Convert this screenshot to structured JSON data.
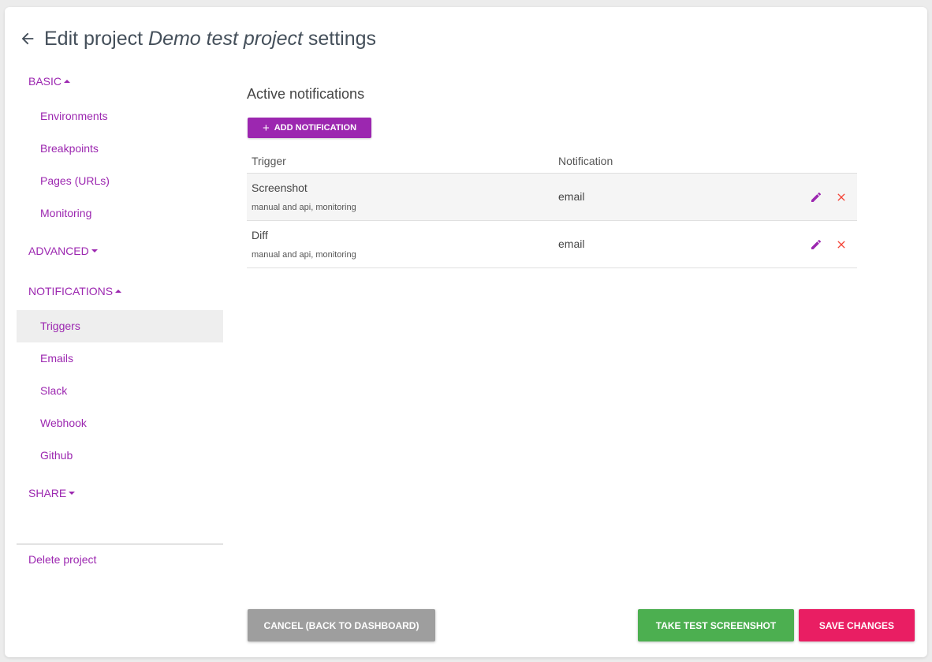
{
  "header": {
    "title_prefix": "Edit project",
    "project_name": "Demo test project",
    "title_suffix": "settings"
  },
  "sidebar": {
    "basic": {
      "label": "BASIC",
      "expanded": true,
      "items": [
        "Environments",
        "Breakpoints",
        "Pages (URLs)",
        "Monitoring"
      ]
    },
    "advanced": {
      "label": "ADVANCED",
      "expanded": false
    },
    "notifications": {
      "label": "NOTIFICATIONS",
      "expanded": true,
      "items": [
        "Triggers",
        "Emails",
        "Slack",
        "Webhook",
        "Github"
      ],
      "active": "Triggers"
    },
    "share": {
      "label": "SHARE",
      "expanded": false
    },
    "delete_label": "Delete project"
  },
  "main": {
    "section_title": "Active notifications",
    "add_button_label": "ADD NOTIFICATION",
    "table": {
      "columns": [
        "Trigger",
        "Notification"
      ],
      "rows": [
        {
          "trigger": "Screenshot",
          "sub": "manual and api, monitoring",
          "notification": "email"
        },
        {
          "trigger": "Diff",
          "sub": "manual and api, monitoring",
          "notification": "email"
        }
      ]
    }
  },
  "footer": {
    "cancel_label": "CANCEL (BACK TO DASHBOARD)",
    "test_label": "TAKE TEST SCREENSHOT",
    "save_label": "SAVE CHANGES"
  },
  "icons": {
    "back": "arrow-left-icon",
    "add": "plus-icon",
    "edit": "pencil-icon",
    "delete": "close-icon",
    "expanded": "caret-up-icon",
    "collapsed": "caret-down-icon"
  },
  "colors": {
    "accent": "#9c27b0",
    "danger": "#f44336",
    "cancel": "#9e9e9e",
    "test": "#4caf50",
    "save": "#e91e63"
  }
}
